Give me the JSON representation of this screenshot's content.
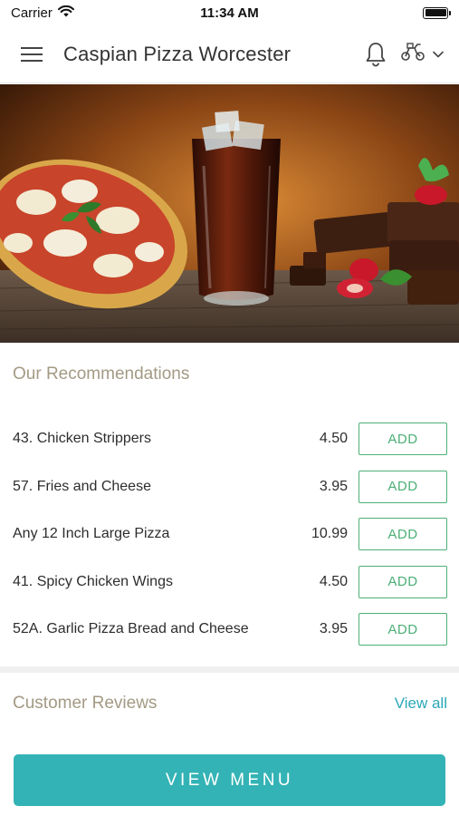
{
  "status_bar": {
    "carrier": "Carrier",
    "time": "11:34 AM"
  },
  "header": {
    "title": "Caspian Pizza Worcester",
    "icons": [
      "hamburger-menu-icon",
      "bell-icon",
      "scooter-icon",
      "chevron-down-icon"
    ]
  },
  "hero": {
    "image_content": "pizza, iced cola drink, chocolate brownies with strawberries"
  },
  "recommendations": {
    "title": "Our Recommendations",
    "add_label": "ADD",
    "items": [
      {
        "name": "43. Chicken Strippers",
        "price": "4.50"
      },
      {
        "name": "57. Fries and Cheese",
        "price": "3.95"
      },
      {
        "name": "Any 12 Inch Large Pizza",
        "price": "10.99"
      },
      {
        "name": "41. Spicy Chicken Wings",
        "price": "4.50"
      },
      {
        "name": "52A. Garlic Pizza Bread and Cheese",
        "price": "3.95"
      }
    ]
  },
  "reviews": {
    "title": "Customer Reviews",
    "view_all": "View all"
  },
  "footer": {
    "view_menu_label": "VIEW MENU"
  },
  "colors": {
    "accent_teal": "#33b3b5",
    "add_green": "#4caf76",
    "section_title": "#a39a84",
    "link_teal": "#2ba7b9"
  }
}
